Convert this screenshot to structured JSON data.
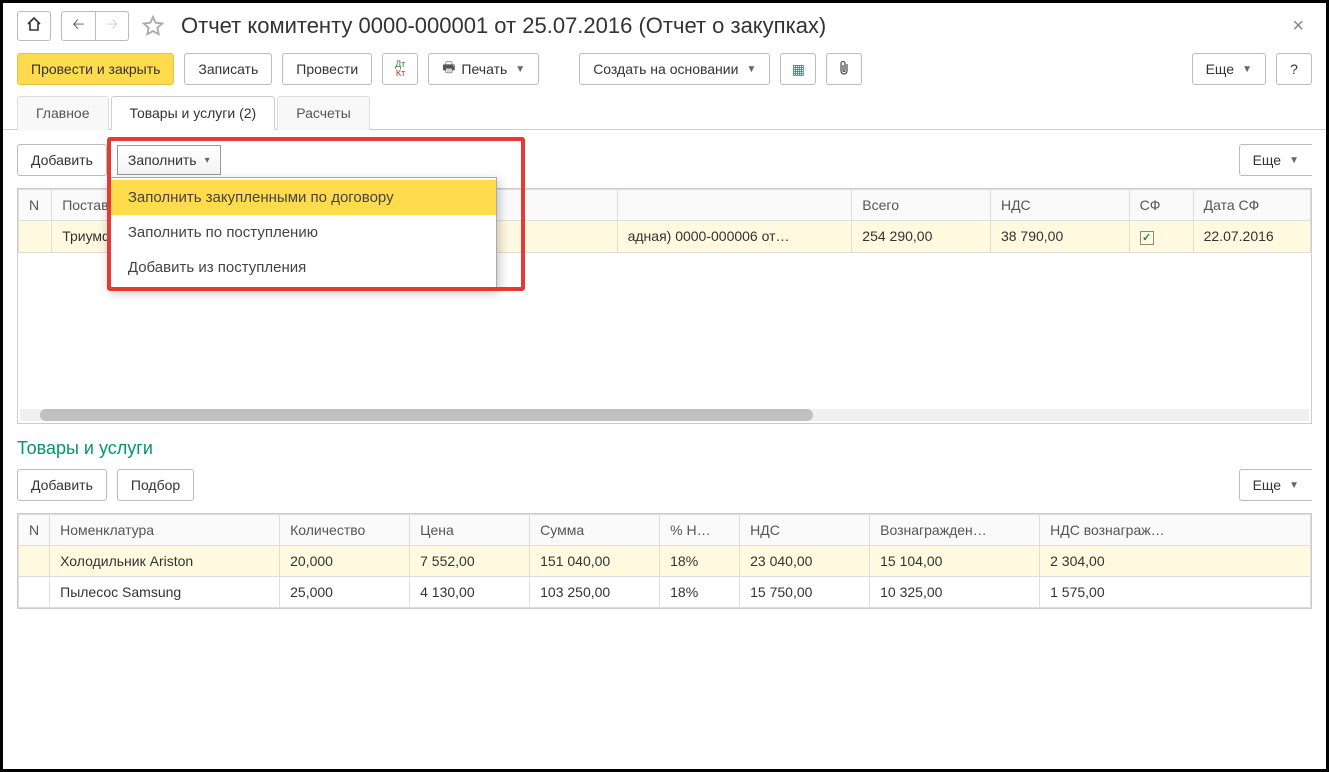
{
  "header": {
    "title": "Отчет комитенту 0000-000001 от 25.07.2016 (Отчет о закупках)"
  },
  "toolbar": {
    "post_close": "Провести и закрыть",
    "write": "Записать",
    "post": "Провести",
    "print": "Печать",
    "create_based": "Создать на основании",
    "more": "Еще",
    "help": "?"
  },
  "tabs": {
    "main": "Главное",
    "goods": "Товары и услуги (2)",
    "calc": "Расчеты"
  },
  "subtoolbar": {
    "add": "Добавить",
    "fill": "Заполнить",
    "more": "Еще"
  },
  "fill_menu": {
    "item1": "Заполнить закупленными по договору",
    "item2": "Заполнить по поступлению",
    "item3": "Добавить из поступления"
  },
  "table1": {
    "headers": {
      "n": "N",
      "supplier": "Поставщик",
      "doc": "",
      "total": "Всего",
      "vat": "НДС",
      "sf": "СФ",
      "sf_date": "Дата СФ"
    },
    "row": {
      "supplier": "Триумф ЗА",
      "doc_tail": "адная) 0000-000006 от…",
      "total": "254 290,00",
      "vat": "38 790,00",
      "sf_date": "22.07.2016"
    }
  },
  "section2": {
    "title": "Товары и услуги",
    "add": "Добавить",
    "pick": "Подбор",
    "more": "Еще"
  },
  "table2": {
    "headers": {
      "n": "N",
      "nomen": "Номенклатура",
      "qty": "Количество",
      "price": "Цена",
      "sum": "Сумма",
      "vat_pct": "% Н…",
      "vat": "НДС",
      "reward": "Вознагражден…",
      "vat_reward": "НДС вознаграж…"
    },
    "rows": [
      {
        "nomen": "Холодильник Ariston",
        "qty": "20,000",
        "price": "7 552,00",
        "sum": "151 040,00",
        "vat_pct": "18%",
        "vat": "23 040,00",
        "reward": "15 104,00",
        "vat_reward": "2 304,00"
      },
      {
        "nomen": "Пылесос Samsung",
        "qty": "25,000",
        "price": "4 130,00",
        "sum": "103 250,00",
        "vat_pct": "18%",
        "vat": "15 750,00",
        "reward": "10 325,00",
        "vat_reward": "1 575,00"
      }
    ]
  }
}
